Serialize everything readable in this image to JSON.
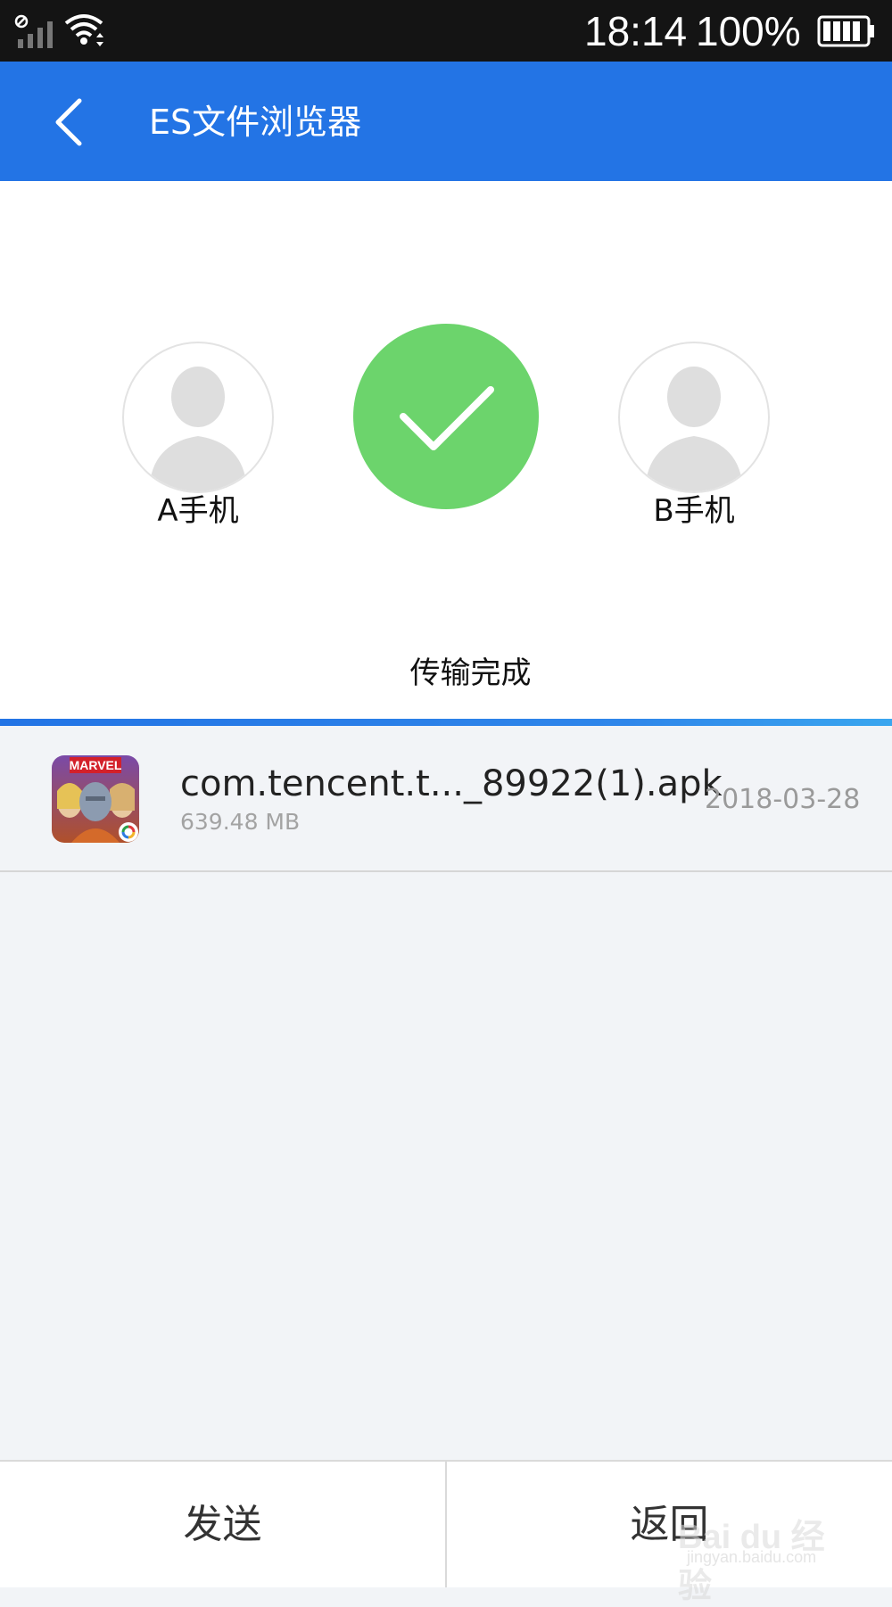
{
  "status_bar": {
    "time": "18:14",
    "battery_percent": "100%",
    "icons": [
      "signal-icon",
      "wifi-icon",
      "battery-icon"
    ]
  },
  "app_bar": {
    "title": "ES文件浏览器",
    "back_icon": "chevron-left-icon",
    "color": "#2374e5"
  },
  "transfer": {
    "sender_label": "A手机",
    "receiver_label": "B手机",
    "status_text": "传输完成",
    "status_icon": "check-icon",
    "status_color": "#6cd46c"
  },
  "files": [
    {
      "name": "com.tencent.t..._89922(1).apk",
      "size": "639.48 MB",
      "date": "2018-03-28",
      "icon": "marvel-app-icon",
      "icon_text": "MARVEL"
    }
  ],
  "bottom_bar": {
    "send_label": "发送",
    "back_label": "返回"
  },
  "watermark": {
    "text": "Bai du 经验",
    "sub": "jingyan.baidu.com"
  }
}
